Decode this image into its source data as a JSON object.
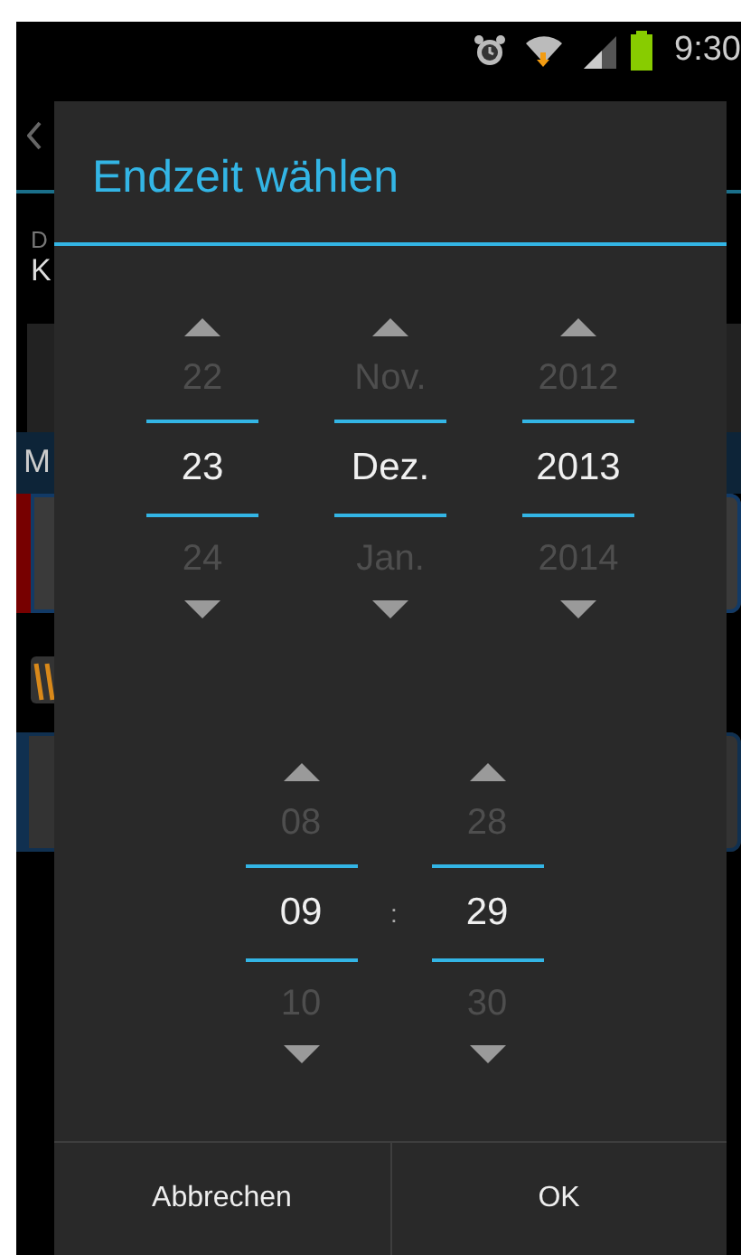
{
  "status_bar": {
    "time": "9:30"
  },
  "background": {
    "labels": [
      "D",
      "K"
    ],
    "section": "M"
  },
  "dialog": {
    "title": "Endzeit wählen",
    "date_pickers": [
      {
        "previous": "22",
        "value": "23",
        "next": "24"
      },
      {
        "previous": "Nov.",
        "value": "Dez.",
        "next": "Jan."
      },
      {
        "previous": "2012",
        "value": "2013",
        "next": "2014"
      }
    ],
    "time_pickers": [
      {
        "previous": "08",
        "value": "09",
        "next": "10"
      },
      {
        "previous": "28",
        "value": "29",
        "next": "30"
      }
    ],
    "time_separator": ":",
    "buttons": [
      "Abbrechen",
      "OK"
    ]
  }
}
